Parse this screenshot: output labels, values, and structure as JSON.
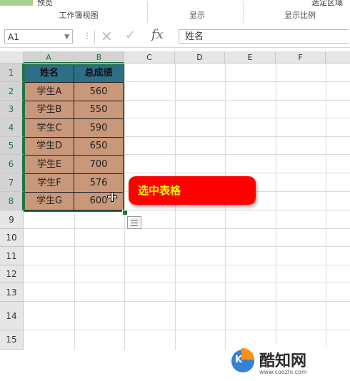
{
  "ribbon": {
    "top_left_text": "预览",
    "top_right_text": "选定区域",
    "groups": [
      "工作簿视图",
      "显示",
      "显示比例"
    ]
  },
  "formula_bar": {
    "name_box": "A1",
    "formula_value": "姓名",
    "fx_label": "fx"
  },
  "columns": [
    "A",
    "B",
    "C",
    "D",
    "E",
    "F"
  ],
  "rows": [
    "1",
    "2",
    "3",
    "4",
    "5",
    "6",
    "7",
    "8",
    "9",
    "10",
    "11",
    "12",
    "13",
    "14",
    "15"
  ],
  "table": {
    "headers": [
      "姓名",
      "总成绩"
    ],
    "rows": [
      [
        "学生A",
        "560"
      ],
      [
        "学生B",
        "550"
      ],
      [
        "学生C",
        "590"
      ],
      [
        "学生D",
        "650"
      ],
      [
        "学生E",
        "700"
      ],
      [
        "学生F",
        "576"
      ],
      [
        "学生G",
        "600"
      ]
    ]
  },
  "callout": {
    "text": "选中表格"
  },
  "watermark": {
    "name": "酷知网",
    "url": "www.coozhi.com",
    "logo_text": "K"
  },
  "colors": {
    "header_fill": "#2e6e86",
    "data_fill": "#c9987a",
    "selection_border": "#217346",
    "callout_fill": "#ff0000",
    "callout_text": "#ffff00"
  }
}
